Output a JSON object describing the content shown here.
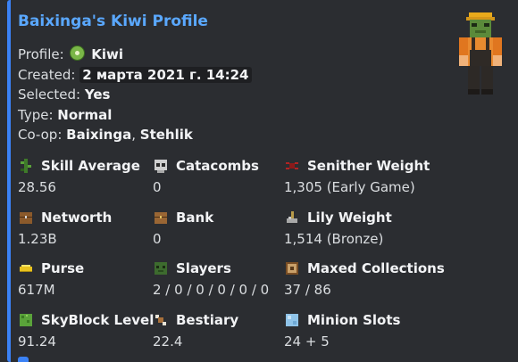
{
  "embed": {
    "title": "Baixinga's Kiwi Profile",
    "accent_color": "#3b82f6"
  },
  "info": {
    "profile_label": "Profile:",
    "profile_value": "Kiwi",
    "created_label": "Created:",
    "created_value": "2 марта 2021 г. 14:24",
    "selected_label": "Selected:",
    "selected_value": "Yes",
    "type_label": "Type:",
    "type_value": "Normal",
    "coop_label": "Co-op:",
    "coop_member1": "Baixinga",
    "coop_sep": ",",
    "coop_member2": "Stehlik"
  },
  "fields": [
    {
      "name": "Skill Average",
      "value": "28.56",
      "icon": "vine-icon"
    },
    {
      "name": "Catacombs",
      "value": "0",
      "icon": "skull-icon"
    },
    {
      "name": "Senither Weight",
      "value": "1,305 (Early Game)",
      "icon": "spider-icon"
    },
    {
      "name": "Networth",
      "value": "1.23B",
      "icon": "chest-icon"
    },
    {
      "name": "Bank",
      "value": "0",
      "icon": "bank-chest-icon"
    },
    {
      "name": "Lily Weight",
      "value": "1,514 (Bronze)",
      "icon": "lily-icon"
    },
    {
      "name": "Purse",
      "value": "617M",
      "icon": "gold-ingot-icon"
    },
    {
      "name": "Slayers",
      "value": "2 / 0 / 0 / 0 / 0 / 0",
      "icon": "zombie-head-icon"
    },
    {
      "name": "Maxed Collections",
      "value": "37 / 86",
      "icon": "item-frame-icon"
    },
    {
      "name": "SkyBlock Level",
      "value": "91.24",
      "icon": "leaves-block-icon"
    },
    {
      "name": "Bestiary",
      "value": "22.4",
      "icon": "bone-icon"
    },
    {
      "name": "Minion Slots",
      "value": "24 + 5",
      "icon": "ice-block-icon"
    }
  ]
}
